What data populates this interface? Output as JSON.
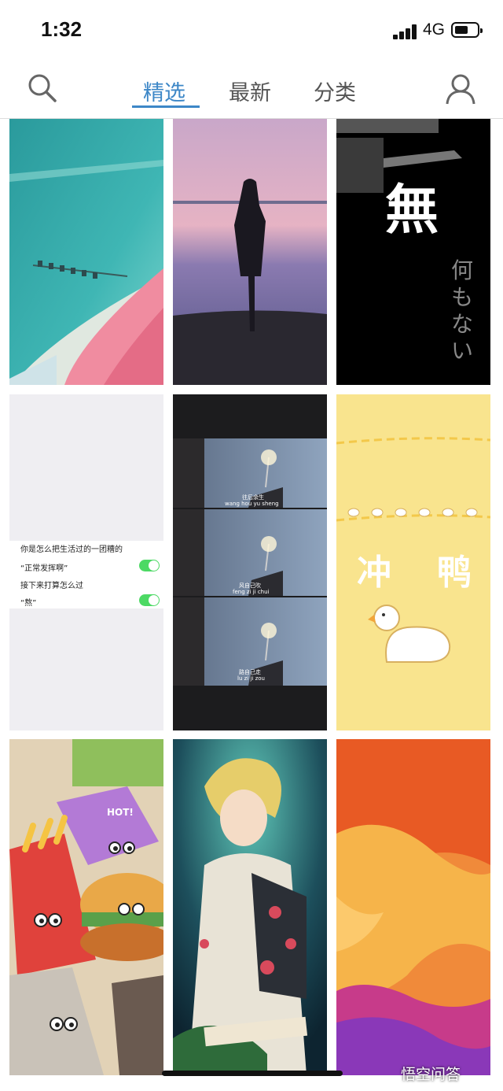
{
  "status": {
    "time": "1:32",
    "network": "4G"
  },
  "nav": {
    "tabs": [
      {
        "label": "精选",
        "active": true
      },
      {
        "label": "最新",
        "active": false
      },
      {
        "label": "分类",
        "active": false
      }
    ],
    "accent": "#3d87c7"
  },
  "wallpapers": {
    "w3": {
      "title": "無",
      "subtitle": "何もない"
    },
    "w4": {
      "lines": [
        "你是怎么把生活过的一团糟的",
        "“正常发挥啊”",
        "接下来打算怎么过",
        "“熬”"
      ]
    },
    "w5": {
      "captions": [
        "往后余生",
        "wang hou yu sheng",
        "风自己吹",
        "feng zi ji chui",
        "路自己走",
        "lu zi ji zou"
      ]
    },
    "w6": {
      "text_left": "冲",
      "text_right": "鸭"
    },
    "w7": {
      "badge": "HOT!"
    }
  },
  "watermark": "悟空问答"
}
